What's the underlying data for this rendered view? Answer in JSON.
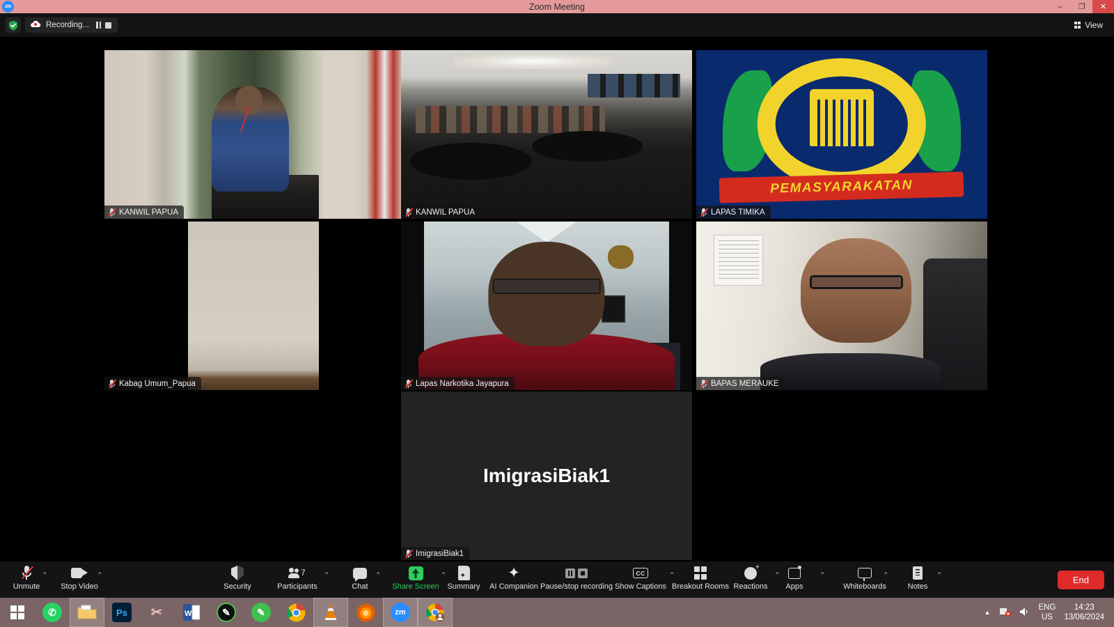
{
  "window": {
    "app_icon": "zoom-logo-icon",
    "title": "Zoom Meeting",
    "minimize": "–",
    "maximize": "❐",
    "close": "✕"
  },
  "header": {
    "security_icon": "shield-check-icon",
    "recording_icon": "recording-cloud-icon",
    "recording_label": "Recording...",
    "pause_icon": "pause-icon",
    "stop_icon": "stop-icon",
    "view_icon": "grid-view-icon",
    "view_label": "View"
  },
  "participants": [
    {
      "name": "KANWIL PAPUA",
      "muted": true,
      "active_speaker": true
    },
    {
      "name": "KANWIL PAPUA",
      "muted": true,
      "active_speaker": false
    },
    {
      "name": "LAPAS TIMIKA",
      "muted": true,
      "active_speaker": false
    },
    {
      "name": "Kabag Umum_Papua",
      "muted": true,
      "active_speaker": false
    },
    {
      "name": "Lapas Narkotika Jayapura",
      "muted": true,
      "active_speaker": false
    },
    {
      "name": "BAPAS MERAUKE",
      "muted": true,
      "active_speaker": false
    },
    {
      "name": "ImigrasiBiak1",
      "muted": true,
      "active_speaker": false,
      "placeholder_text": "ImigrasiBiak1"
    }
  ],
  "logo_tile": {
    "ribbon_text": "PEMASYARAKATAN"
  },
  "toolbar": {
    "items": [
      {
        "label": "Unmute",
        "icon": "microphone-muted-icon",
        "caret": true,
        "green": false
      },
      {
        "label": "Stop Video",
        "icon": "video-camera-icon",
        "caret": true,
        "green": false
      },
      {
        "label": "Security",
        "icon": "shield-icon",
        "caret": false,
        "green": false
      },
      {
        "label": "Participants",
        "icon": "participants-icon",
        "caret": true,
        "green": false,
        "count": "7"
      },
      {
        "label": "Chat",
        "icon": "chat-bubble-icon",
        "caret": true,
        "green": false
      },
      {
        "label": "Share Screen",
        "icon": "share-screen-icon",
        "caret": true,
        "green": true
      },
      {
        "label": "Summary",
        "icon": "summary-doc-icon",
        "caret": false,
        "green": false
      },
      {
        "label": "AI Companion",
        "icon": "ai-sparkle-icon",
        "caret": false,
        "green": false
      },
      {
        "label": "Pause/stop recording",
        "icon": "pause-stop-record-icon",
        "caret": false,
        "green": false
      },
      {
        "label": "Show Captions",
        "icon": "closed-captions-icon",
        "caret": true,
        "green": false
      },
      {
        "label": "Breakout Rooms",
        "icon": "breakout-rooms-icon",
        "caret": false,
        "green": false
      },
      {
        "label": "Reactions",
        "icon": "reactions-smiley-icon",
        "caret": true,
        "green": false
      },
      {
        "label": "Apps",
        "icon": "apps-icon",
        "caret": true,
        "green": false
      },
      {
        "label": "Whiteboards",
        "icon": "whiteboard-icon",
        "caret": true,
        "green": false
      },
      {
        "label": "Notes",
        "icon": "notes-icon",
        "caret": true,
        "green": false
      }
    ],
    "end_label": "End",
    "end_color": "#e02b2b"
  },
  "taskbar": {
    "items": [
      {
        "name": "start-button",
        "icon": "windows-logo-icon",
        "glyph": "",
        "color": "#ffffff",
        "selected": false
      },
      {
        "name": "whatsapp",
        "icon": "whatsapp-icon",
        "glyph": "✆",
        "color": "#25d366",
        "selected": false
      },
      {
        "name": "file-explorer",
        "icon": "file-explorer-icon",
        "glyph": "Ὄ1",
        "color": "#f5c86a",
        "selected": true
      },
      {
        "name": "photoshop",
        "icon": "photoshop-icon",
        "glyph": "Ps",
        "color": "#31a8ff",
        "selected": false
      },
      {
        "name": "snipping-tool",
        "icon": "snipping-tool-icon",
        "glyph": "✂",
        "color": "#e8a0a0",
        "selected": false
      },
      {
        "name": "word",
        "icon": "microsoft-word-icon",
        "glyph": "W",
        "color": "#2b579a",
        "selected": false
      },
      {
        "name": "black-app",
        "icon": "pen-dark-icon",
        "glyph": "✎",
        "color": "#111111",
        "selected": false
      },
      {
        "name": "green-notes",
        "icon": "green-pen-icon",
        "glyph": "✎",
        "color": "#3fbf4f",
        "selected": false
      },
      {
        "name": "chrome",
        "icon": "google-chrome-icon",
        "glyph": "",
        "color": "#4285f4",
        "selected": false
      },
      {
        "name": "vlc",
        "icon": "vlc-cone-icon",
        "glyph": "▲",
        "color": "#e8800a",
        "selected": true
      },
      {
        "name": "firefox",
        "icon": "firefox-icon",
        "glyph": "◉",
        "color": "#e66000",
        "selected": false
      },
      {
        "name": "zoom",
        "icon": "zoom-app-icon",
        "glyph": "zm",
        "color": "#2d8cff",
        "selected": true
      },
      {
        "name": "chrome-profile",
        "icon": "chrome-profile-icon",
        "glyph": "",
        "color": "#4285f4",
        "selected": true
      }
    ],
    "tray": {
      "chevron": "▲",
      "network_icon": "network-disconnected-icon",
      "volume_icon": "speaker-icon",
      "language_line1": "ENG",
      "language_line2": "US",
      "time": "14:23",
      "date": "13/06/2024"
    }
  }
}
